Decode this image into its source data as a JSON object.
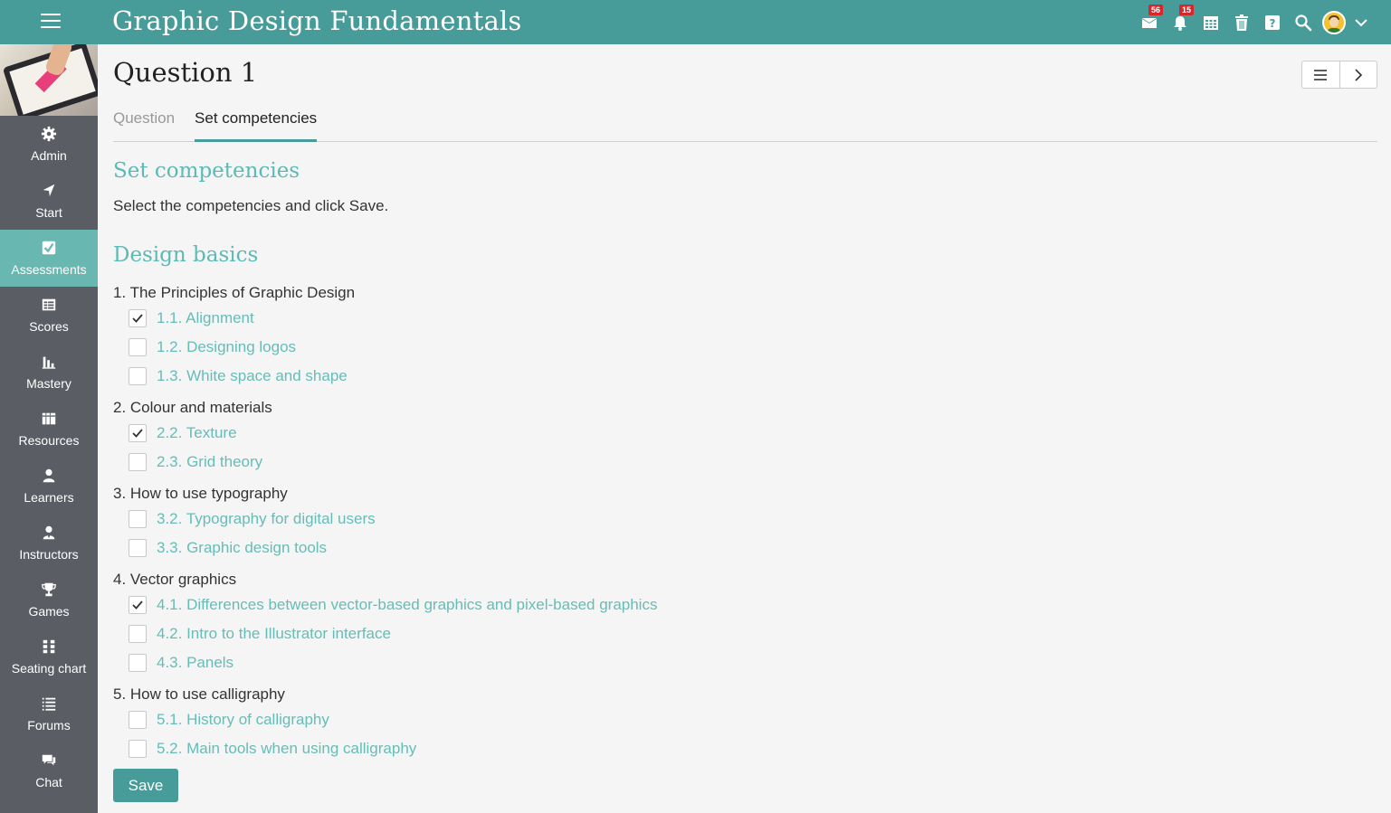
{
  "header": {
    "app_title": "Graphic Design Fundamentals",
    "messages_badge": "56",
    "notifications_badge": "15",
    "icons": [
      "menu-icon",
      "mail-icon",
      "bell-icon",
      "calendar-icon",
      "trash-icon",
      "help-icon",
      "search-icon",
      "avatar",
      "chevron-down-icon"
    ],
    "bar_color": "#479b98"
  },
  "sidebar": {
    "items": [
      {
        "label": "Admin",
        "icon": "gear-icon"
      },
      {
        "label": "Start",
        "icon": "navigation-arrow-icon"
      },
      {
        "label": "Assessments",
        "icon": "checkbox-icon",
        "active": true
      },
      {
        "label": "Scores",
        "icon": "table-icon"
      },
      {
        "label": "Mastery",
        "icon": "bar-chart-icon"
      },
      {
        "label": "Resources",
        "icon": "books-icon"
      },
      {
        "label": "Learners",
        "icon": "person-icon"
      },
      {
        "label": "Instructors",
        "icon": "instructor-icon"
      },
      {
        "label": "Games",
        "icon": "trophy-icon"
      },
      {
        "label": "Seating chart",
        "icon": "seating-grid-icon"
      },
      {
        "label": "Forums",
        "icon": "list-icon"
      },
      {
        "label": "Chat",
        "icon": "chat-bubbles-icon"
      }
    ],
    "active_color": "#69b7b1",
    "background": "#5a5e64"
  },
  "main": {
    "page_title": "Question 1",
    "tabs": [
      {
        "label": "Question",
        "active": false
      },
      {
        "label": "Set competencies",
        "active": true
      }
    ],
    "section_heading": "Set competencies",
    "instruction": "Select the competencies and click Save.",
    "group_heading": "Design basics",
    "topics": [
      {
        "label": "1. The Principles of Graphic Design",
        "items": [
          {
            "label": "1.1. Alignment",
            "checked": true
          },
          {
            "label": "1.2. Designing logos",
            "checked": false
          },
          {
            "label": "1.3. White space and shape",
            "checked": false
          }
        ]
      },
      {
        "label": "2. Colour and materials",
        "items": [
          {
            "label": "2.2. Texture",
            "checked": true
          },
          {
            "label": "2.3. Grid theory",
            "checked": false
          }
        ]
      },
      {
        "label": "3. How to use typography",
        "items": [
          {
            "label": "3.2. Typography for digital users",
            "checked": false
          },
          {
            "label": "3.3. Graphic design tools",
            "checked": false
          }
        ]
      },
      {
        "label": "4. Vector graphics",
        "items": [
          {
            "label": "4.1. Differences between vector-based graphics and pixel-based graphics",
            "checked": true
          },
          {
            "label": "4.2. Intro to the Illustrator interface",
            "checked": false
          },
          {
            "label": "4.3. Panels",
            "checked": false
          }
        ]
      },
      {
        "label": "5. How to use calligraphy",
        "items": [
          {
            "label": "5.1. History of calligraphy",
            "checked": false
          },
          {
            "label": "5.2. Main tools when using calligraphy",
            "checked": false
          }
        ]
      }
    ],
    "save_label": "Save",
    "accent_color": "#5bbab4"
  }
}
